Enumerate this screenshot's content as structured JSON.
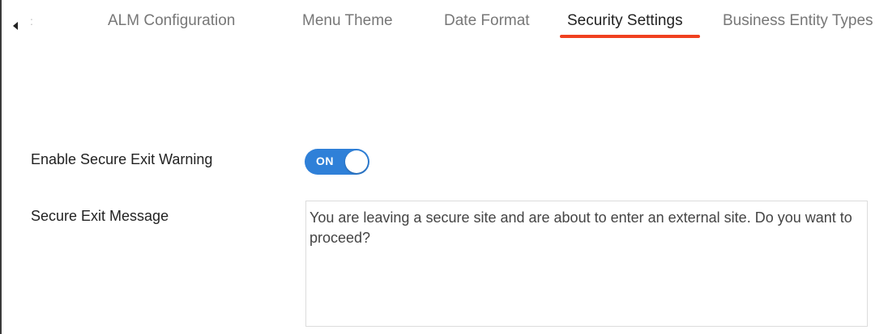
{
  "tabs": [
    {
      "label": "ALM Configuration",
      "active": false
    },
    {
      "label": "Menu Theme",
      "active": false
    },
    {
      "label": "Date Format",
      "active": false
    },
    {
      "label": "Security Settings",
      "active": true
    },
    {
      "label": "Business Entity Types",
      "active": false
    }
  ],
  "icons": {
    "scroll_left": "caret-left-icon"
  },
  "colors": {
    "active_tab_underline": "#f0401f",
    "toggle_on": "#2f80d8",
    "label_text": "#222222",
    "inactive_tab_text": "#777777"
  },
  "settings": {
    "secure_exit_warning": {
      "label": "Enable Secure Exit Warning",
      "toggle_label": "ON",
      "enabled": true
    },
    "secure_exit_message": {
      "label": "Secure Exit Message",
      "value": "You are leaving a secure site and are about to enter an external site. Do you want to proceed?"
    }
  }
}
